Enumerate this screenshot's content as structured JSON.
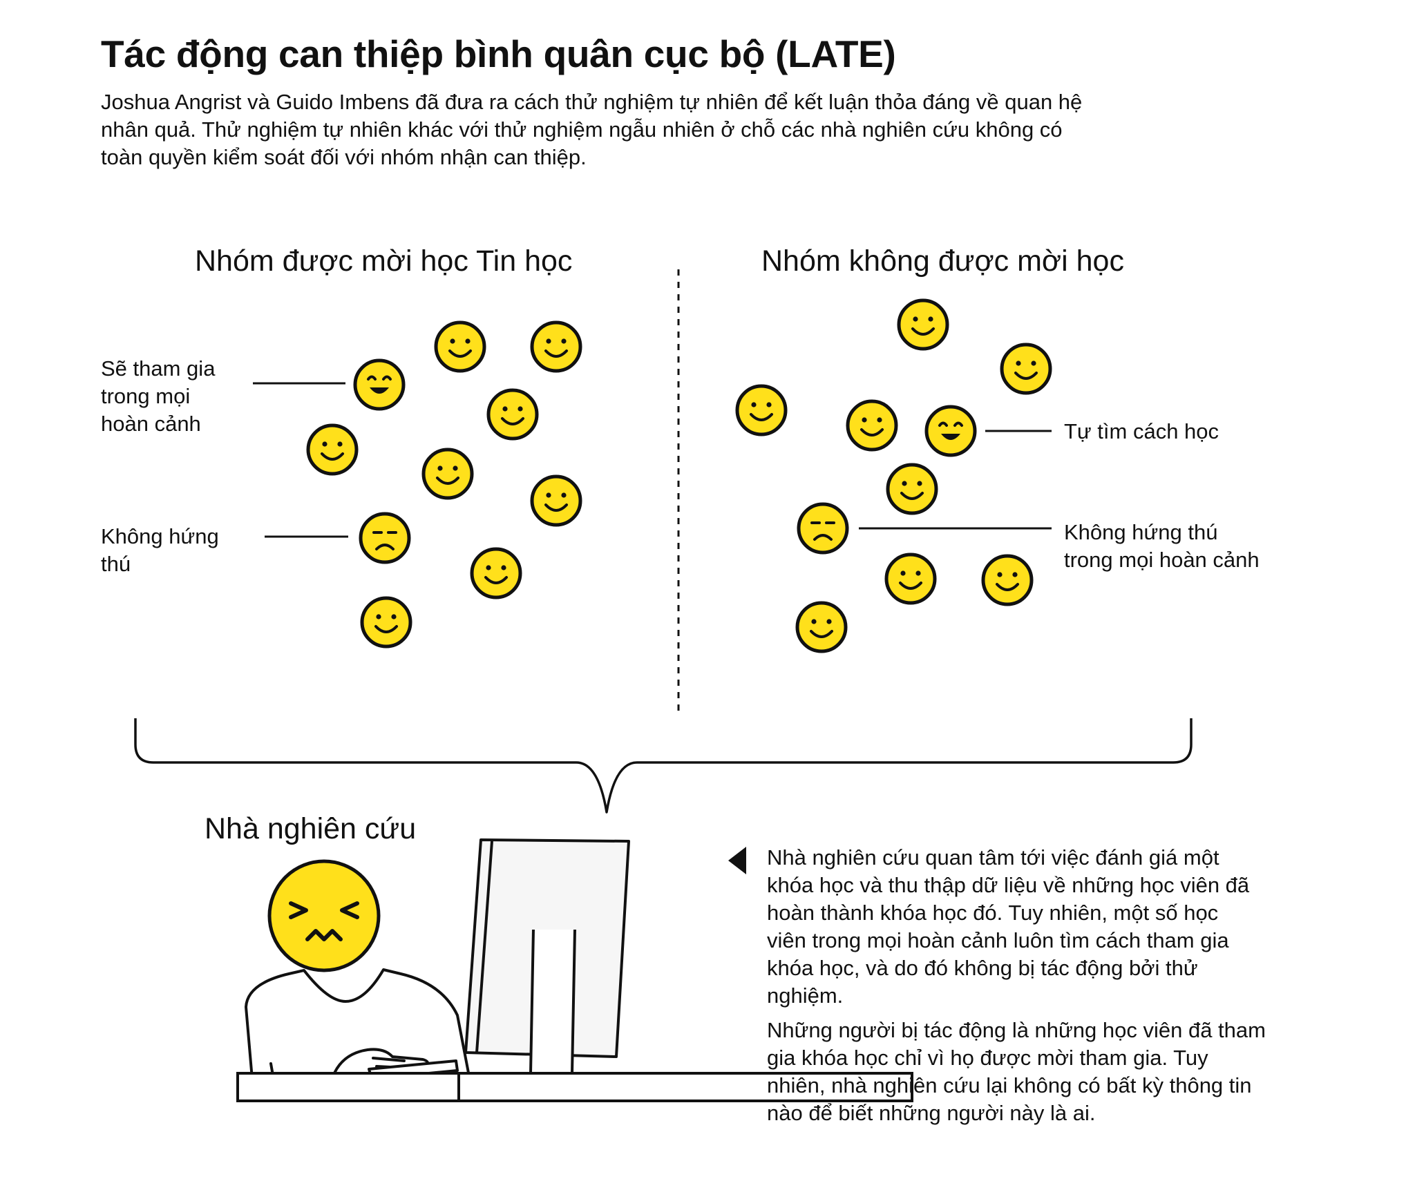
{
  "title": "Tác động can thiệp bình quân cục bộ (LATE)",
  "intro": {
    "lines": [
      "Joshua Angrist và Guido Imbens đã đưa ra cách  thử nghiệm tự nhiên để kết luận thỏa đáng về quan hệ",
      "nhân quả. Thử nghiệm tự nhiên khác với thử nghiệm ngẫu nhiên ở chỗ các nhà nghiên cứu không có",
      "toàn quyền kiểm soát đối với nhóm nhận can thiệp."
    ]
  },
  "groups": {
    "left": {
      "heading": "Nhóm được mời học Tin học",
      "label_will_join": [
        "Sẽ tham gia",
        "trong mọi",
        "hoàn cảnh"
      ],
      "label_not_interested": [
        "Không hứng",
        "thú"
      ]
    },
    "right": {
      "heading": "Nhóm không được mời học",
      "label_self_learn": "Tự tìm cách học",
      "label_not_interested": [
        "Không hứng thú",
        "trong mọi hoàn cảnh"
      ]
    }
  },
  "researcher": {
    "label": "Nhà nghiên cứu"
  },
  "description": {
    "paragraph1": [
      "Nhà nghiên cứu quan tâm tới việc đánh giá một",
      "khóa học và thu thập dữ liệu về những học viên đã",
      "hoàn thành khóa học đó. Tuy nhiên, một số học",
      "viên trong mọi hoàn cảnh luôn tìm cách tham gia",
      "khóa học, và do đó không bị tác động bởi thử",
      "nghiệm."
    ],
    "paragraph2": [
      "Những người bị tác động là những học viên đã tham",
      "gia khóa học chỉ vì họ được mời tham gia. Tuy",
      "nhiên, nhà nghiên cứu lại không có bất kỳ thông tin",
      "nào để biết những người này là ai."
    ]
  },
  "colors": {
    "face_fill": "#FFE01B",
    "stroke": "#111111",
    "background": "#FFFFFF",
    "monitor_fill": "#F6F6F6"
  }
}
